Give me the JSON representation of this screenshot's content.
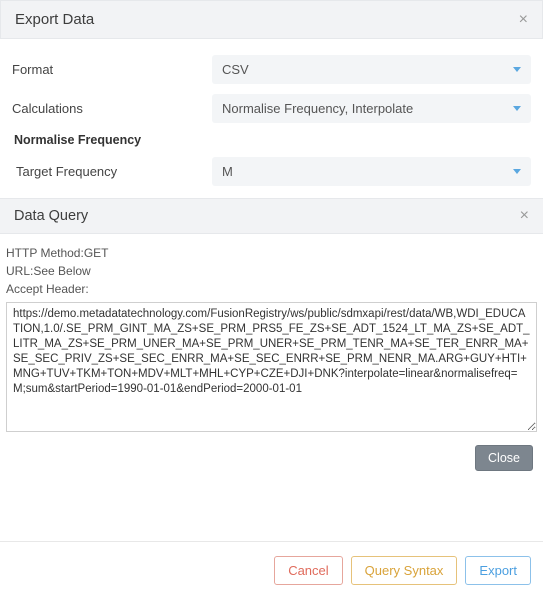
{
  "header": {
    "title": "Export Data"
  },
  "form": {
    "format_label": "Format",
    "format_value": "CSV",
    "calculations_label": "Calculations",
    "calculations_value": "Normalise Frequency, Interpolate",
    "normalise_section": "Normalise Frequency",
    "target_freq_label": "Target Frequency",
    "target_freq_value": "M"
  },
  "query": {
    "title": "Data Query",
    "http_method_label": "HTTP Method:",
    "http_method_value": "GET",
    "url_label": "URL:",
    "url_note": "See Below",
    "accept_label": "Accept Header:",
    "url_value": "https://demo.metadatatechnology.com/FusionRegistry/ws/public/sdmxapi/rest/data/WB,WDI_EDUCATION,1.0/.SE_PRM_GINT_MA_ZS+SE_PRM_PRS5_FE_ZS+SE_ADT_1524_LT_MA_ZS+SE_ADT_LITR_MA_ZS+SE_PRM_UNER_MA+SE_PRM_UNER+SE_PRM_TENR_MA+SE_TER_ENRR_MA+SE_SEC_PRIV_ZS+SE_SEC_ENRR_MA+SE_SEC_ENRR+SE_PRM_NENR_MA.ARG+GUY+HTI+MNG+TUV+TKM+TON+MDV+MLT+MHL+CYP+CZE+DJI+DNK?interpolate=linear&normalisefreq=M;sum&startPeriod=1990-01-01&endPeriod=2000-01-01"
  },
  "buttons": {
    "close": "Close",
    "cancel": "Cancel",
    "query_syntax": "Query Syntax",
    "export": "Export"
  }
}
